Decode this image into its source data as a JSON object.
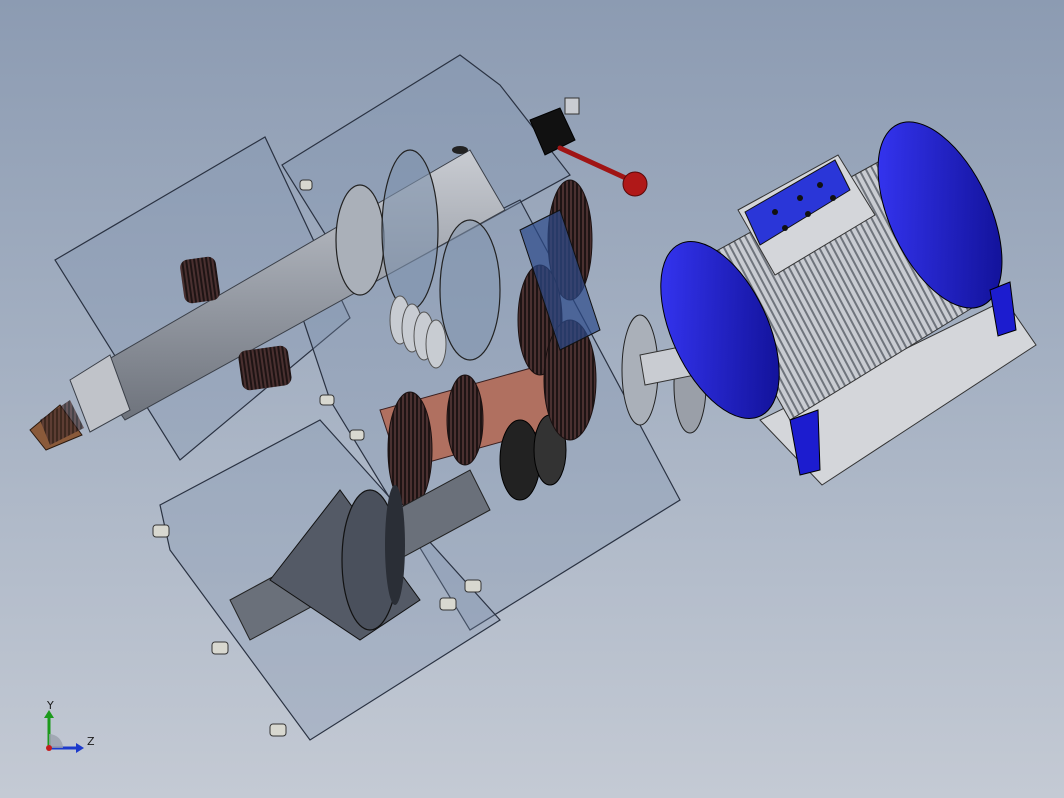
{
  "viewport": {
    "background_top": "#8c9bb2",
    "background_bottom": "#c4cad4"
  },
  "model": {
    "housing_color": "#7f93ad",
    "motor_color": "#1c1ccf",
    "lever_color": "#b01818",
    "shaft_color": "#9a9fa8",
    "gear_color": "#3a2a2a",
    "copper_color": "#b07060"
  },
  "triad": {
    "y_label": "Y",
    "z_label": "Z",
    "y_color": "#1c9a1c",
    "z_color": "#1c3acc",
    "origin_color": "#c41c1c"
  }
}
